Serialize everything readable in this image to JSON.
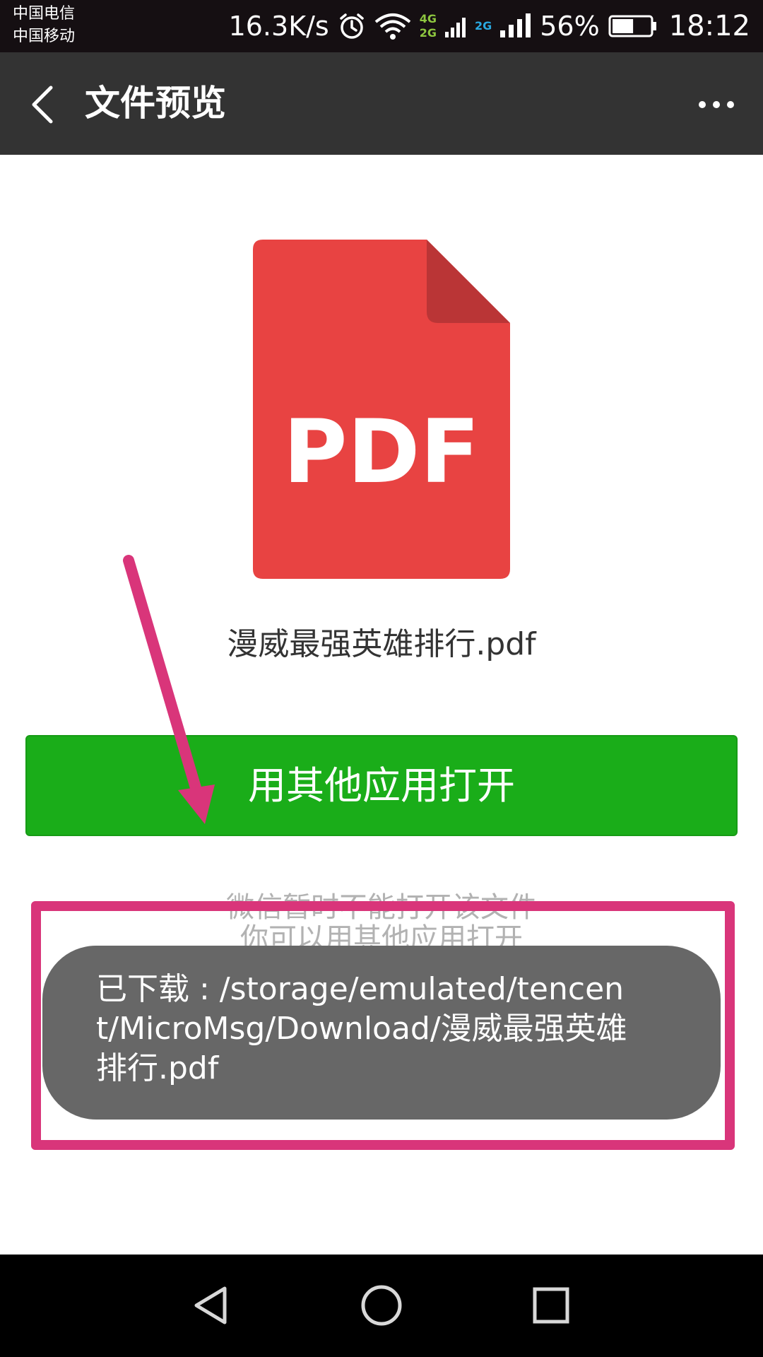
{
  "status_bar": {
    "carrier_1": "中国电信",
    "carrier_2": "中国移动",
    "net_speed": "16.3K/s",
    "network_badge_top": "4G",
    "network_badge_bottom": "2G",
    "network_badge_second": "2G",
    "battery_percent": "56%",
    "battery_level": 0.56,
    "time": "18:12",
    "icons": [
      "alarm-icon",
      "wifi-icon",
      "signal-icon",
      "battery-icon"
    ]
  },
  "header": {
    "title": "文件预览",
    "back_icon": "chevron-left-icon",
    "more_icon": "more-dots-icon"
  },
  "file": {
    "type_label": "PDF",
    "name": "漫威最强英雄排行.pdf",
    "icon_color": "#e84342",
    "fold_color": "#ba3536"
  },
  "actions": {
    "open_with_label": "用其他应用打开",
    "button_color": "#1aad19"
  },
  "hint": {
    "line_1": "微信暂时不能打开该文件",
    "line_2": "你可以用其他应用打开"
  },
  "toast": {
    "message": "已下载 : /storage/emulated/tencent/MicroMsg/Download/漫威最强英雄排行.pdf"
  },
  "annotation": {
    "color": "#d9357a"
  },
  "nav_bar": {
    "icons": [
      "back-triangle-icon",
      "home-circle-icon",
      "recents-square-icon"
    ]
  }
}
